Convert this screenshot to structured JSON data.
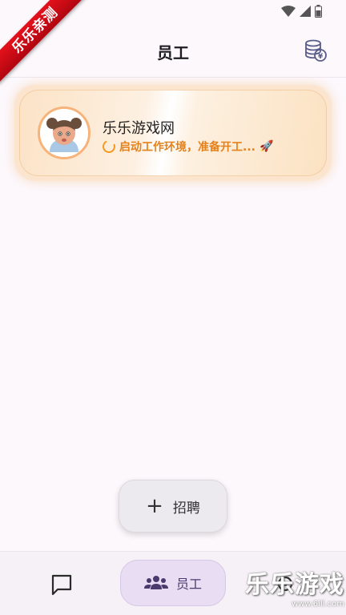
{
  "ribbon": {
    "text": "乐乐亲测"
  },
  "header": {
    "title": "员工",
    "coins_icon": "coin-stack-icon"
  },
  "employees": [
    {
      "name": "乐乐游戏网",
      "status": "启动工作环境，准备开工...",
      "status_emoji": "🚀",
      "avatar_icon": "cartoon-girl-avatar-icon"
    }
  ],
  "fab": {
    "label": "招聘",
    "icon": "plus-icon"
  },
  "bottom_nav": {
    "items": [
      {
        "icon": "chat-bubble-icon",
        "label": ""
      },
      {
        "icon": "people-icon",
        "label": "员工",
        "active": true
      },
      {
        "icon": "settings-icon",
        "label": ""
      }
    ]
  },
  "watermark": {
    "title": "乐乐游戏",
    "url": "www.6ill.com"
  },
  "colors": {
    "accent": "#e4811b",
    "card": "#fbe3c6",
    "nav_active": "#e8ddf3"
  }
}
